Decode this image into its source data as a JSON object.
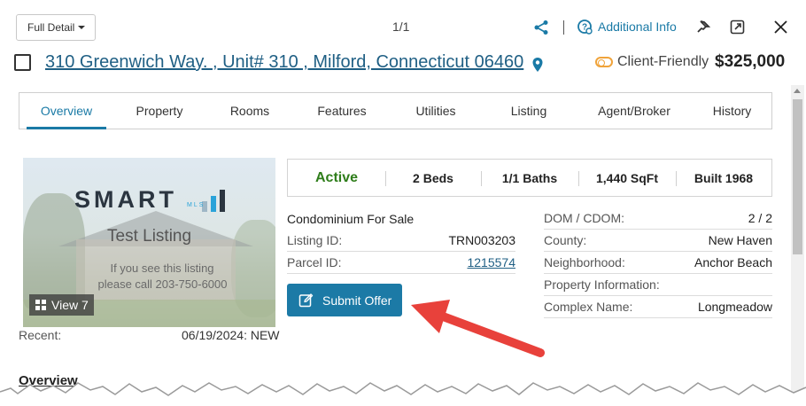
{
  "toolbar": {
    "view_select": "Full Detail",
    "pager": "1/1",
    "additional_info": "Additional Info"
  },
  "listing": {
    "address": "310 Greenwich Way. , Unit# 310 , Milford, Connecticut 06460",
    "client_friendly_label": "Client-Friendly",
    "price": "$325,000"
  },
  "tabs": [
    {
      "label": "Overview",
      "active": true
    },
    {
      "label": "Property",
      "active": false
    },
    {
      "label": "Rooms",
      "active": false
    },
    {
      "label": "Features",
      "active": false
    },
    {
      "label": "Utilities",
      "active": false
    },
    {
      "label": "Listing",
      "active": false
    },
    {
      "label": "Agent/Broker",
      "active": false
    },
    {
      "label": "History",
      "active": false
    }
  ],
  "photo": {
    "logo_text": "SMART",
    "logo_sub": "MLS",
    "test_listing": "Test Listing",
    "line1": "If you see this listing",
    "line2": "please call 203-750-6000",
    "view_button": "View 7"
  },
  "summary": {
    "status": "Active",
    "beds": "2 Beds",
    "baths": "1/1 Baths",
    "sqft": "1,440 SqFt",
    "built": "Built 1968"
  },
  "details_left": {
    "type": "Condominium For Sale",
    "rows": [
      {
        "label": "Listing ID:",
        "value": "TRN003203"
      },
      {
        "label": "Parcel ID:",
        "value": "1215574"
      }
    ]
  },
  "details_right": {
    "rows": [
      {
        "label": "DOM / CDOM:",
        "value": "2 / 2"
      },
      {
        "label": "County:",
        "value": "New Haven"
      },
      {
        "label": "Neighborhood:",
        "value": "Anchor Beach"
      },
      {
        "label": "Property Information:",
        "value": ""
      },
      {
        "label": "Complex Name:",
        "value": "Longmeadow"
      }
    ]
  },
  "submit_offer": "Submit Offer",
  "recent": {
    "label": "Recent:",
    "value": "06/19/2024: NEW"
  },
  "section_heading": "Overview",
  "colors": {
    "accent": "#1c7aa6",
    "active_status": "#2e7d1a",
    "arrow": "#e8413b",
    "client_friendly": "#f0a33a"
  }
}
